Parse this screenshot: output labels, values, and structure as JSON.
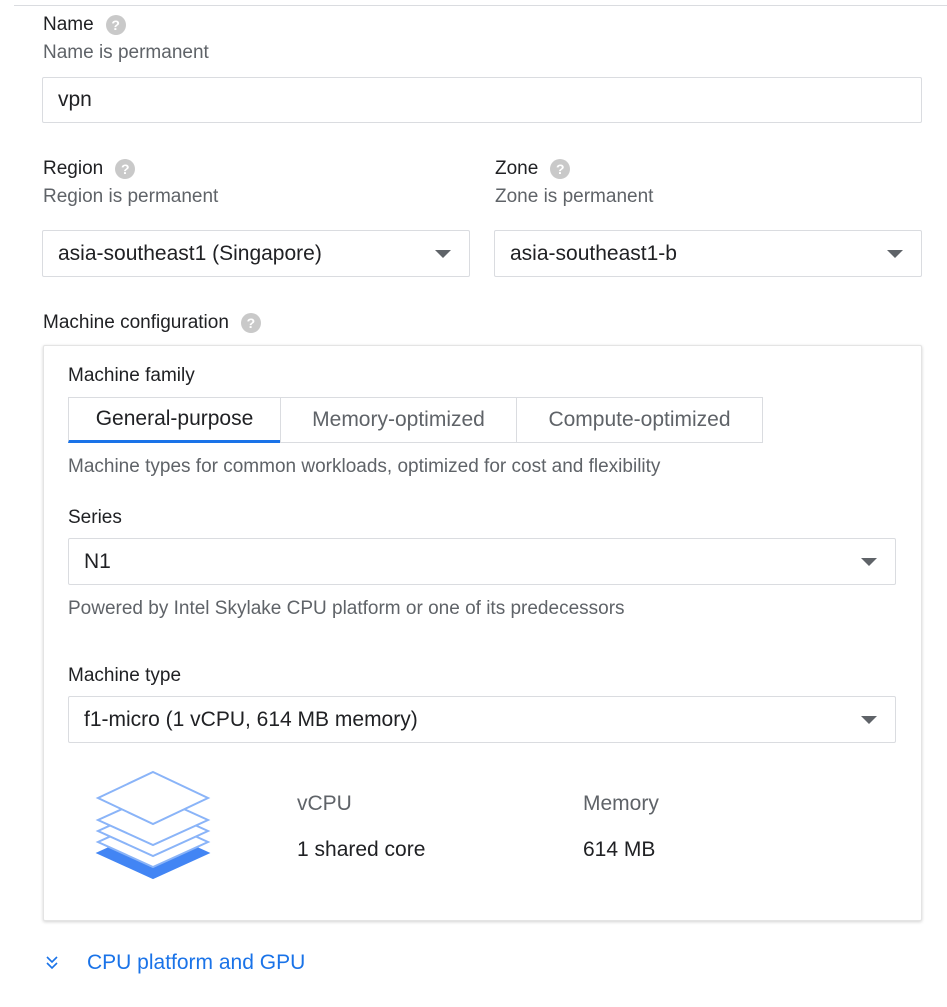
{
  "name": {
    "label": "Name",
    "hint": "Name is permanent",
    "value": "vpn"
  },
  "region": {
    "label": "Region",
    "hint": "Region is permanent",
    "value": "asia-southeast1 (Singapore)"
  },
  "zone": {
    "label": "Zone",
    "hint": "Zone is permanent",
    "value": "asia-southeast1-b"
  },
  "machine_configuration": {
    "label": "Machine configuration",
    "family": {
      "label": "Machine family",
      "tabs": [
        "General-purpose",
        "Memory-optimized",
        "Compute-optimized"
      ],
      "selected": "General-purpose",
      "description": "Machine types for common workloads, optimized for cost and flexibility"
    },
    "series": {
      "label": "Series",
      "value": "N1",
      "description": "Powered by Intel Skylake CPU platform or one of its predecessors"
    },
    "machine_type": {
      "label": "Machine type",
      "value": "f1-micro (1 vCPU, 614 MB memory)"
    },
    "specs": {
      "vcpu_label": "vCPU",
      "vcpu_value": "1 shared core",
      "memory_label": "Memory",
      "memory_value": "614 MB"
    }
  },
  "expander": {
    "label": "CPU platform and GPU",
    "icon": "double-chevron-down-icon"
  },
  "colors": {
    "accent": "#1a73e8",
    "border": "#dadce0",
    "help_icon": "#c9c9c9"
  }
}
